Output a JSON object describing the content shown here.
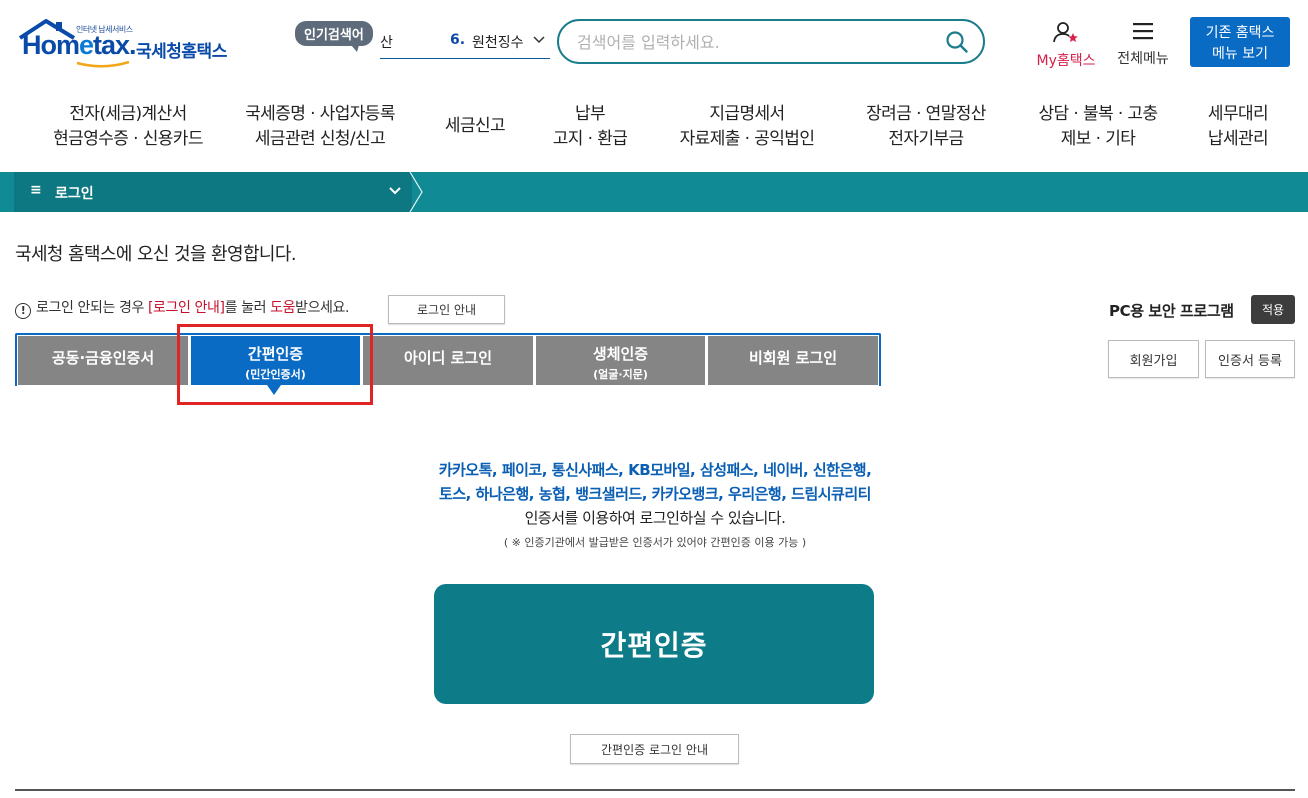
{
  "header": {
    "logo_tagline": "인터넷 납세서비스",
    "logo_brand_a": "Hom",
    "logo_brand_e": "e",
    "logo_brand_b": "tax.",
    "logo_kr": "국세청홈택스",
    "popular_label": "인기검색어",
    "ticker_partial": "산",
    "ticker_rank": "6.",
    "ticker_term": "원천징수",
    "search_placeholder": "검색어를 입력하세요.",
    "my_hometax": "My홈택스",
    "all_menu": "전체메뉴",
    "old_view_line1": "기존 홈택스",
    "old_view_line2": "메뉴 보기"
  },
  "gnb": [
    {
      "line1": "전자(세금)계산서",
      "line2": "현금영수증 · 신용카드"
    },
    {
      "line1": "국세증명 · 사업자등록",
      "line2": "세금관련 신청/신고"
    },
    {
      "line1": "세금신고",
      "line2": ""
    },
    {
      "line1": "납부",
      "line2": "고지 · 환급"
    },
    {
      "line1": "지급명세서",
      "line2": "자료제출 · 공익법인"
    },
    {
      "line1": "장려금 · 연말정산",
      "line2": "전자기부금"
    },
    {
      "line1": "상담 · 불복 · 고충",
      "line2": "제보 · 기타"
    },
    {
      "line1": "세무대리",
      "line2": "납세관리"
    }
  ],
  "breadcrumb": {
    "current": "로그인"
  },
  "content": {
    "welcome": "국세청 홈택스에 오신 것을 환영합니다.",
    "help_pre": "로그인 안되는 경우 ",
    "help_link1": "[로그인 안내]",
    "help_mid": "를 눌러 ",
    "help_link2": "도움",
    "help_post": "받으세요.",
    "help_button": "로그인 안내",
    "pc_security_label": "PC용 보안 프로그램",
    "apply_button": "적용",
    "tabs": [
      {
        "label": "공동·금융인증서",
        "sub": ""
      },
      {
        "label": "간편인증",
        "sub": "(민간인증서)"
      },
      {
        "label": "아이디 로그인",
        "sub": ""
      },
      {
        "label": "생체인증",
        "sub": "(얼굴·지문)"
      },
      {
        "label": "비회원 로그인",
        "sub": ""
      }
    ],
    "join_button": "회원가입",
    "cert_register_button": "인증서 등록",
    "providers_line1": "카카오톡, 페이코, 통신사패스, KB모바일, 삼성패스, 네이버, 신한은행,",
    "providers_line2": "토스, 하나은행, 농협, 뱅크샐러드, 카카오뱅크, 우리은행, 드림시큐리티",
    "providers_line3": "인증서를 이용하여 로그인하실 수 있습니다.",
    "note": "( ※ 인증기관에서 발급받은 인증서가 있어야 간편인증 이용 가능 )",
    "main_button": "간편인증",
    "guide_button": "간편인증 로그인 안내"
  },
  "colors": {
    "brand_blue": "#0a6bc4",
    "teal": "#0e7b88",
    "highlight_red": "#e02424",
    "my_hometax_pink": "#d6224a"
  }
}
